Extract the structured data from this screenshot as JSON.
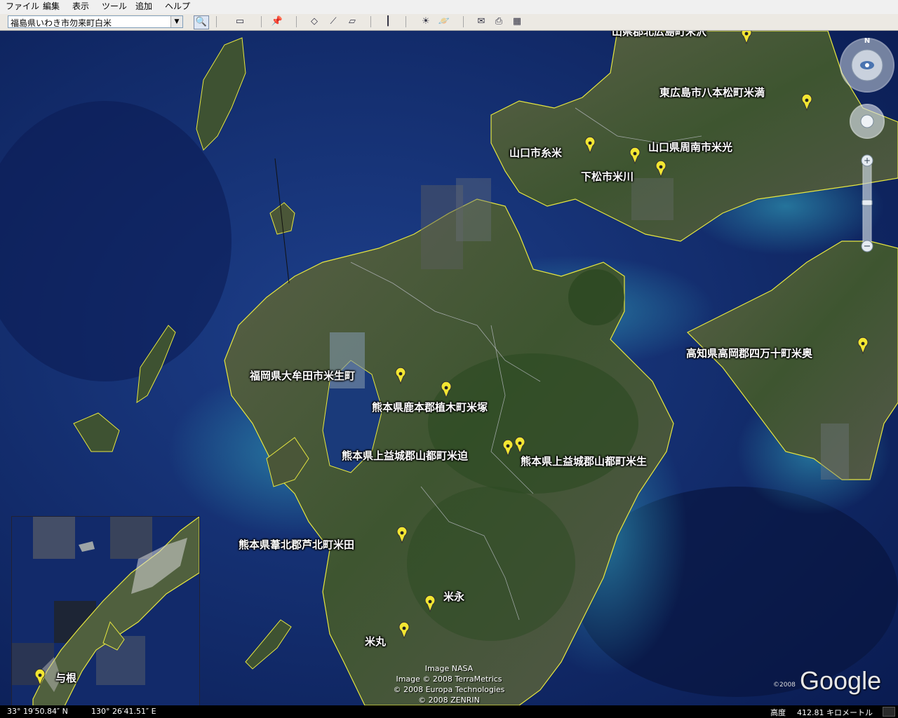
{
  "menu": [
    "ファイル",
    "編集",
    "表示",
    "ツール",
    "追加",
    "ヘルプ"
  ],
  "search": {
    "value": "福島県いわき市勿来町白米"
  },
  "toolbar_icons": [
    "search-icon",
    "sidebar-icon",
    "placemark-icon",
    "polygon-icon",
    "path-icon",
    "overlay-icon",
    "ruler-icon",
    "sun-icon",
    "planet-icon",
    "email-icon",
    "print-icon",
    "maps-icon"
  ],
  "placemarks": [
    {
      "label": "山口市糸米"
    },
    {
      "label": "山口県周南市米光"
    },
    {
      "label": "下松市米川"
    },
    {
      "label": "東広島市八本松町米満"
    },
    {
      "label": "高知県高岡郡四万十町米奥"
    },
    {
      "label": "福岡県大牟田市米生町"
    },
    {
      "label": "熊本県鹿本郡植木町米塚"
    },
    {
      "label": "熊本県上益城郡山都町米迫"
    },
    {
      "label": "熊本県上益城郡山都町米生"
    },
    {
      "label": "熊本県葦北郡芦北町米田"
    },
    {
      "label": "米永"
    },
    {
      "label": "米丸"
    },
    {
      "label": "与根"
    },
    {
      "label": "山県郡北広島町米沢"
    }
  ],
  "attribution": [
    "Image NASA",
    "Image © 2008 TerraMetrics",
    "© 2008 Europa Technologies",
    "© 2008 ZENRIN"
  ],
  "logo": {
    "text": "Google",
    "year": "©2008"
  },
  "status": {
    "lat": "33° 19′50.84″ N",
    "lon": "130° 26′41.51″ E",
    "alt_label": "高度",
    "alt_value": "412.81 キロメートル"
  },
  "compass": {
    "north": "N"
  },
  "colors": {
    "ocean": "#0d2a6b",
    "land": "#4c5a3a",
    "coast": "#e6e640",
    "marker": "#f2e632"
  }
}
